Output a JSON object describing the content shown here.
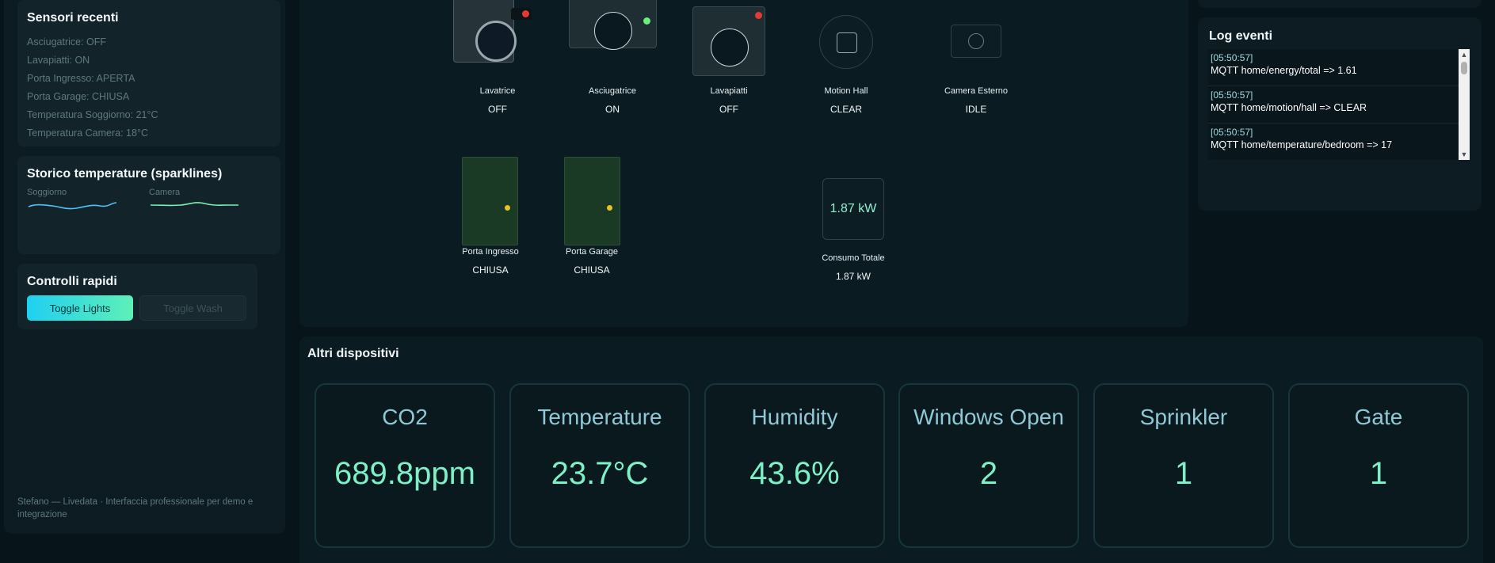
{
  "sensors": {
    "title": "Sensori recenti",
    "items": [
      "Asciugatrice: OFF",
      "Lavapiatti: ON",
      "Porta Ingresso: APERTA",
      "Porta Garage: CHIUSA",
      "Temperatura Soggiorno: 21°C",
      "Temperatura Camera: 18°C"
    ]
  },
  "sparklines": {
    "title": "Storico temperature (sparklines)",
    "series": [
      {
        "label": "Soggiorno",
        "color": "#4fc3f7"
      },
      {
        "label": "Camera",
        "color": "#7ef0b0"
      }
    ]
  },
  "controls": {
    "title": "Controlli rapidi",
    "toggle_lights": "Toggle Lights",
    "toggle_wash": "Toggle Wash"
  },
  "footer": "Stefano — Livedata · Interfaccia professionale per demo e integrazione",
  "devices": {
    "lavatrice": {
      "name": "Lavatrice",
      "state": "OFF",
      "indicator": "#e53935"
    },
    "asciugatrice": {
      "name": "Asciugatrice",
      "state": "ON",
      "indicator": "#69f07a"
    },
    "lavapiatti": {
      "name": "Lavapiatti",
      "state": "OFF",
      "indicator": "#e53935"
    },
    "motion_hall": {
      "name": "Motion Hall",
      "state": "CLEAR"
    },
    "camera_esterno": {
      "name": "Camera Esterno",
      "state": "IDLE"
    },
    "porta_ingresso": {
      "name": "Porta Ingresso",
      "state": "CHIUSA"
    },
    "porta_garage": {
      "name": "Porta Garage",
      "state": "CHIUSA"
    },
    "energy": {
      "display": "1.87 kW",
      "name": "Consumo Totale",
      "state": "1.87 kW"
    }
  },
  "log": {
    "title": "Log eventi",
    "entries": [
      {
        "time": "[05:50:57]",
        "msg": "MQTT home/energy/total => 1.61"
      },
      {
        "time": "[05:50:57]",
        "msg": "MQTT home/motion/hall => CLEAR"
      },
      {
        "time": "[05:50:57]",
        "msg": "MQTT home/temperature/bedroom => 17"
      }
    ]
  },
  "other": {
    "title": "Altri dispositivi",
    "tiles": [
      {
        "label": "CO2",
        "value": "689.8ppm"
      },
      {
        "label": "Temperature",
        "value": "23.7°C"
      },
      {
        "label": "Humidity",
        "value": "43.6%"
      },
      {
        "label": "Windows Open",
        "value": "2"
      },
      {
        "label": "Sprinkler",
        "value": "1"
      },
      {
        "label": "Gate",
        "value": "1"
      }
    ]
  }
}
